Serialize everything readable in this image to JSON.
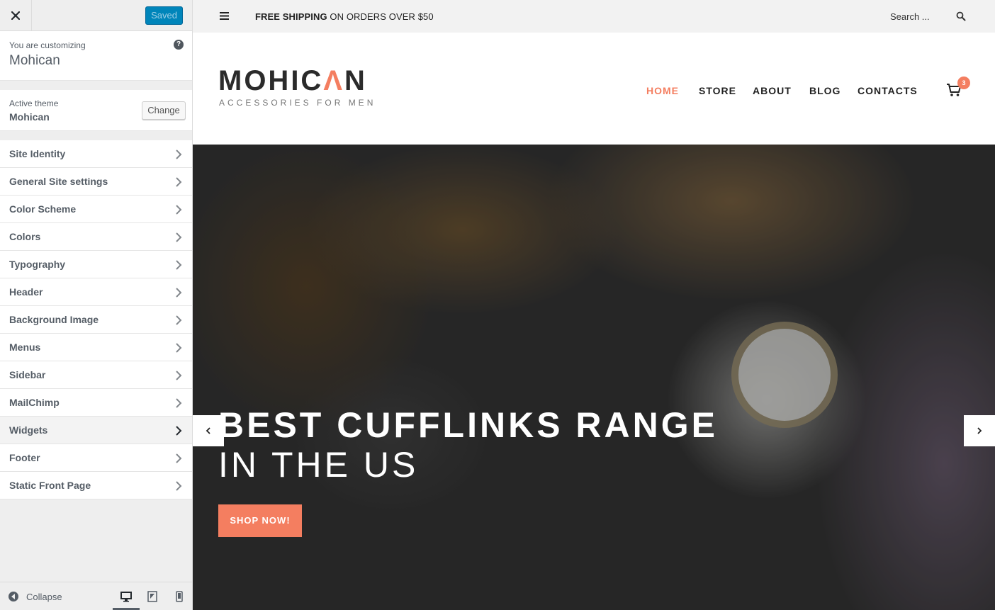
{
  "customizer": {
    "saved_label": "Saved",
    "customizing_label": "You are customizing",
    "site_name": "Mohican",
    "help_glyph": "?",
    "active_theme_label": "Active theme",
    "active_theme_name": "Mohican",
    "change_label": "Change",
    "panels": [
      {
        "label": "Site Identity"
      },
      {
        "label": "General Site settings"
      },
      {
        "label": "Color Scheme"
      },
      {
        "label": "Colors"
      },
      {
        "label": "Typography"
      },
      {
        "label": "Header"
      },
      {
        "label": "Background Image"
      },
      {
        "label": "Menus"
      },
      {
        "label": "Sidebar"
      },
      {
        "label": "MailChimp"
      },
      {
        "label": "Widgets"
      },
      {
        "label": "Footer"
      },
      {
        "label": "Static Front Page"
      }
    ],
    "collapse_label": "Collapse",
    "active_device": "desktop"
  },
  "preview": {
    "topbar": {
      "shipping_bold": "FREE SHIPPING",
      "shipping_rest": " ON ORDERS OVER $50",
      "search_placeholder": "Search ..."
    },
    "logo": {
      "title_part1": "MOHIC",
      "title_accent": "Λ",
      "title_part2": "N",
      "tagline": "ACCESSORIES FOR MEN"
    },
    "nav": {
      "home": "HOME",
      "store": "STORE",
      "about": "ABOUT",
      "blog": "BLOG",
      "contacts": "CONTACTS"
    },
    "cart_count": "3",
    "hero": {
      "title": "BEST CUFFLINKS RANGE",
      "subtitle": "IN THE US",
      "button_label": "SHOP NOW!"
    }
  },
  "colors": {
    "accent": "#f47e60",
    "saved_button": "#0085ba",
    "sidebar_bg": "#eeeeee",
    "text_dark": "#555d66"
  }
}
